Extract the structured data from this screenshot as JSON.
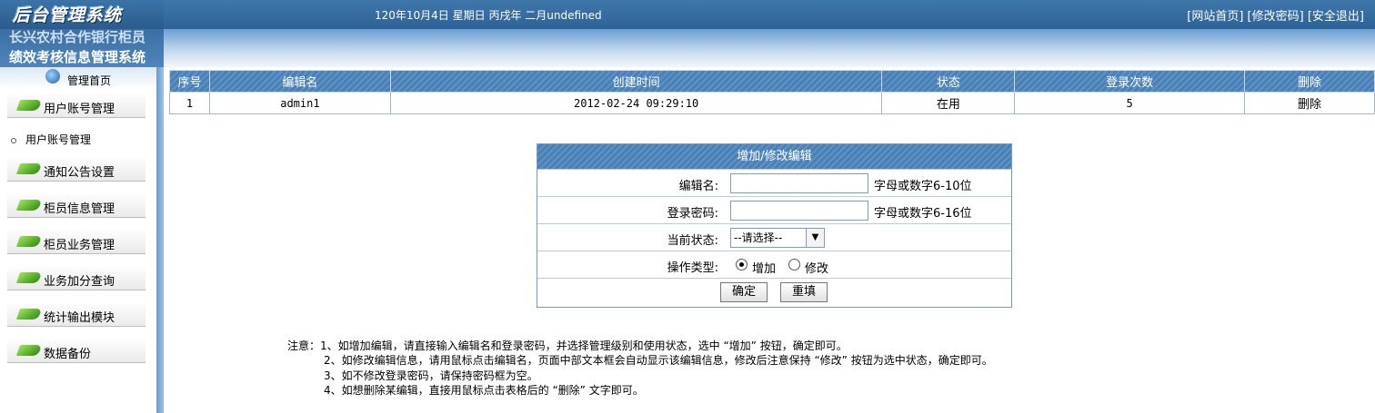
{
  "header": {
    "logo": "后台管理系统",
    "date": "120年10月4日 星期日 丙戌年 二月undefined",
    "links": [
      "[网站首页]",
      "[修改密码]",
      "[安全退出]"
    ]
  },
  "org": {
    "line1": "长兴农村合作银行柜员",
    "line2": "绩效考核信息管理系统"
  },
  "sidebar": {
    "home": "管理首页",
    "items": [
      {
        "label": "用户账号管理"
      },
      {
        "label": "通知公告设置"
      },
      {
        "label": "柜员信息管理"
      },
      {
        "label": "柜员业务管理"
      },
      {
        "label": "业务加分查询"
      },
      {
        "label": "统计输出模块"
      },
      {
        "label": "数据备份"
      }
    ],
    "sub_item": "用户账号管理"
  },
  "table": {
    "headers": [
      "序号",
      "编辑名",
      "创建时间",
      "状态",
      "登录次数",
      "删除"
    ],
    "rows": [
      [
        "1",
        "admin1",
        "2012-02-24 09:29:10",
        "在用",
        "5",
        "删除"
      ]
    ]
  },
  "form": {
    "title": "增加/修改编辑",
    "name_label": "编辑名:",
    "name_value": "",
    "name_hint": "字母或数字6-10位",
    "password_label": "登录密码:",
    "password_value": "",
    "password_hint": "字母或数字6-16位",
    "status_label": "当前状态:",
    "status_selected": "--请选择--",
    "op_label": "操作类型:",
    "op_add": "增加",
    "op_edit": "修改",
    "confirm": "确定",
    "reset": "重填"
  },
  "notes": {
    "prefix": "注意：",
    "lines": [
      "1、如增加编辑，请直接输入编辑名和登录密码，并选择管理级别和使用状态，选中 “增加” 按钮，确定即可。",
      "2、如修改编辑信息，请用鼠标点击编辑名，页面中部文本框会自动显示该编辑信息，修改后注意保持 “修改” 按钮为选中状态，确定即可。",
      "3、如不修改登录密码，请保持密码框为空。",
      "4、如想删除某编辑，直接用鼠标点击表格后的 “删除” 文字即可。"
    ]
  }
}
